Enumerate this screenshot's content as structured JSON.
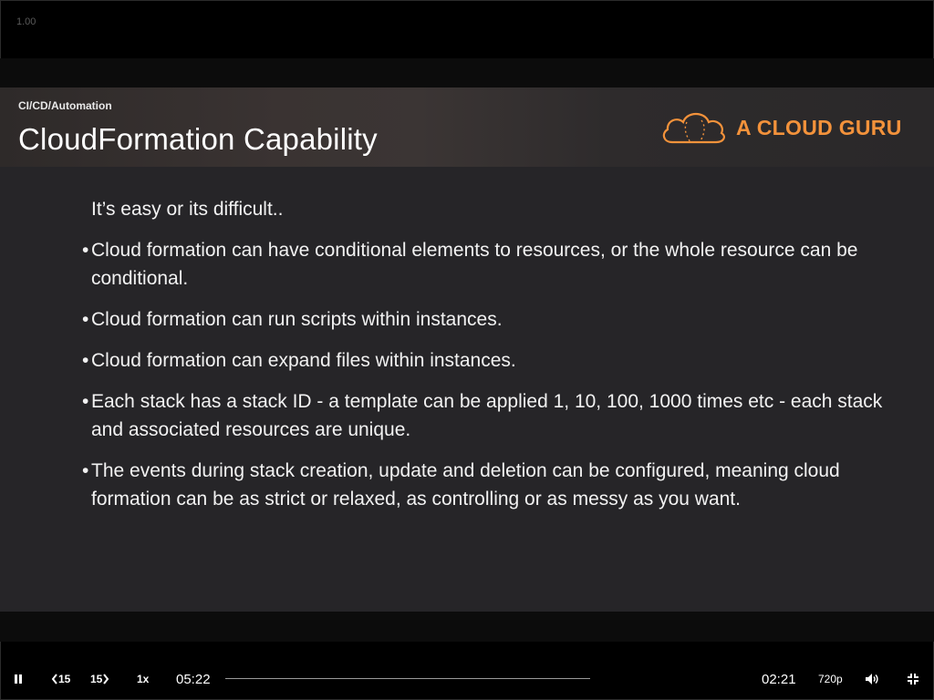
{
  "player": {
    "speed_readout": "1.00",
    "controls": {
      "rewind_label": "15",
      "forward_label": "15",
      "speed_label": "1x",
      "elapsed": "05:22",
      "remaining": "02:21",
      "quality": "720p"
    },
    "icons": [
      "pause-icon",
      "rewind-15-icon",
      "forward-15-icon",
      "volume-icon",
      "exit-fullscreen-icon"
    ]
  },
  "slide": {
    "breadcrumb": "CI/CD/Automation",
    "title": "CloudFormation Capability",
    "logo_text": "A CLOUD GURU",
    "brand_color": "#f3923b",
    "intro": "It’s easy or its difficult..",
    "bullets": [
      "Cloud formation can have conditional elements to resources, or the whole resource can be conditional.",
      "Cloud formation can run scripts within instances.",
      "Cloud formation can expand files within instances.",
      "Each stack has a stack ID - a template can be applied 1, 10, 100, 1000 times etc - each stack and associated resources are unique.",
      "The events during stack creation, update and deletion can be configured, meaning cloud formation can be as strict or relaxed, as controlling or as messy as you want."
    ]
  }
}
